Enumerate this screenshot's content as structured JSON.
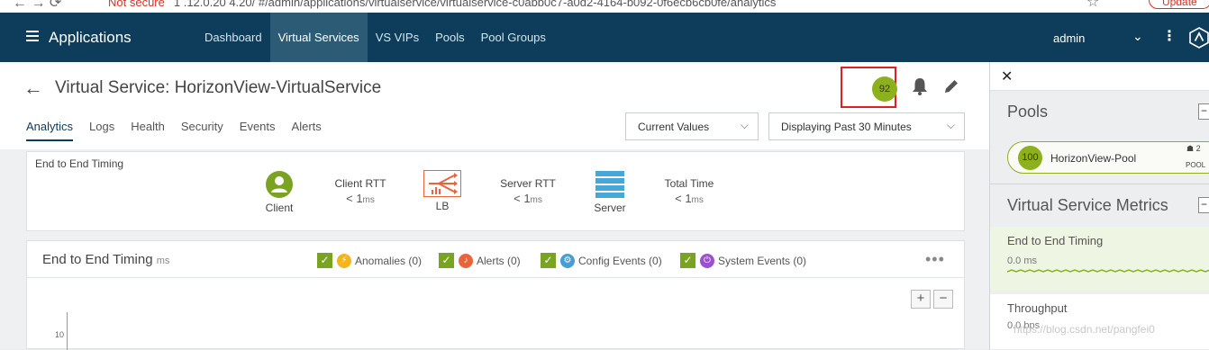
{
  "browser": {
    "nav_glyphs": "←  →  ⟳",
    "not_secure": "Not secure",
    "url_fragment": "1 .12.0.20 4.20/ #/admin/applications/virtualservice/virtualservice-c0abb0c7-a0d2-4164-b092-0f6ecb6cb0fe/analytics",
    "update_label": "Update"
  },
  "topbar": {
    "app_title": "Applications",
    "nav": [
      "Dashboard",
      "Virtual Services",
      "VS VIPs",
      "Pools",
      "Pool Groups"
    ],
    "active_index": 1,
    "user": "admin",
    "kebab": "⋮",
    "chevron": "⌄"
  },
  "header": {
    "title": "Virtual Service:  HorizonView-VirtualService",
    "health_score": "92",
    "tabs": [
      "Analytics",
      "Logs",
      "Health",
      "Security",
      "Events",
      "Alerts"
    ],
    "active_tab": 0,
    "values_select": "Current Values",
    "time_select": "Displaying Past 30 Minutes"
  },
  "timing": {
    "label": "End to End Timing",
    "client_label": "Client",
    "client_rtt_label": "Client RTT",
    "client_rtt_value": "< 1",
    "lb_label": "LB",
    "server_rtt_label": "Server RTT",
    "server_rtt_value": "< 1",
    "server_label": "Server",
    "total_time_label": "Total Time",
    "total_time_value": "< 1",
    "unit": "ms"
  },
  "chart": {
    "title": "End to End Timing",
    "unit": "ms",
    "filters": [
      {
        "label": "Anomalies (0)",
        "color": "#f2b51c",
        "glyph": "⚡"
      },
      {
        "label": "Alerts (0)",
        "color": "#e8643a",
        "glyph": "♪"
      },
      {
        "label": "Config Events (0)",
        "color": "#4a9ecf",
        "glyph": "⚙"
      },
      {
        "label": "System Events (0)",
        "color": "#9b4fd1",
        "glyph": "⏻"
      }
    ],
    "more": "•••",
    "zoom_in": "+",
    "zoom_out": "−",
    "y_tick": "10"
  },
  "side": {
    "close": "✕",
    "pools_heading": "Pools",
    "pool": {
      "health": "100",
      "name": "HorizonView-Pool",
      "count": "2",
      "tag": "POOL"
    },
    "metrics_heading": "Virtual Service Metrics",
    "metrics": [
      {
        "name": "End to End Timing",
        "value": "0.0 ms"
      },
      {
        "name": "Throughput",
        "value": "0.0 bps"
      }
    ],
    "collapse_glyph": "−"
  },
  "watermark": "https://blog.csdn.net/pangfei0",
  "colors": {
    "nav_bg": "#0d3d5a",
    "health_green": "#8cb11d",
    "checkbox_green": "#7aa321",
    "highlight_red": "#e02020"
  }
}
